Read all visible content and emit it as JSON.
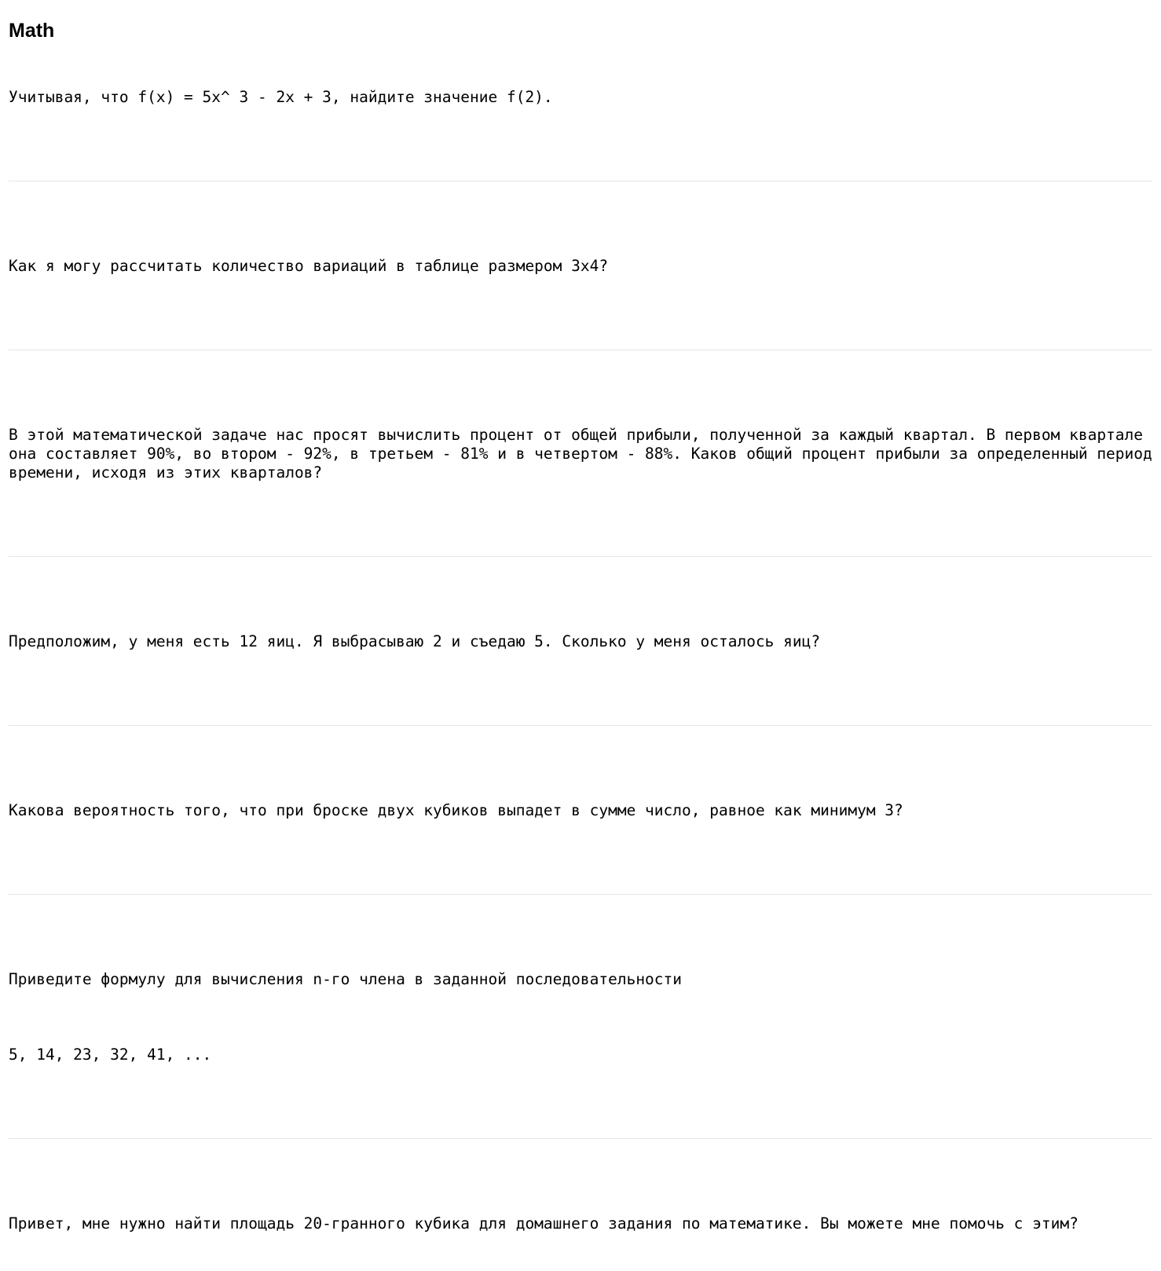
{
  "heading": "Math",
  "prompts": [
    {
      "lines": [
        "Учитывая, что f(x) = 5x^ 3 - 2x + 3, найдите значение f(2)."
      ]
    },
    {
      "lines": [
        "Как я могу рассчитать количество вариаций в таблице размером 3x4?"
      ]
    },
    {
      "lines": [
        "В этой математической задаче нас просят вычислить процент от общей прибыли, полученной за каждый квартал. В первом квартале она составляет 90%, во втором - 92%, в третьем - 81% и в четвертом - 88%. Каков общий процент прибыли за определенный период времени, исходя из этих кварталов?"
      ]
    },
    {
      "lines": [
        "Предположим, у меня есть 12 яиц. Я выбрасываю 2 и съедаю 5. Сколько у меня осталось яиц?"
      ]
    },
    {
      "lines": [
        "Какова вероятность того, что при броске двух кубиков выпадет в сумме число, равное как минимум 3?"
      ]
    },
    {
      "lines": [
        "Приведите формулу для вычисления n-го члена в заданной последовательности",
        "5, 14, 23, 32, 41, ..."
      ]
    },
    {
      "lines": [
        "Привет, мне нужно найти площадь 20-гранного кубика для домашнего задания по математике. Вы можете мне помочь с этим?"
      ]
    }
  ]
}
